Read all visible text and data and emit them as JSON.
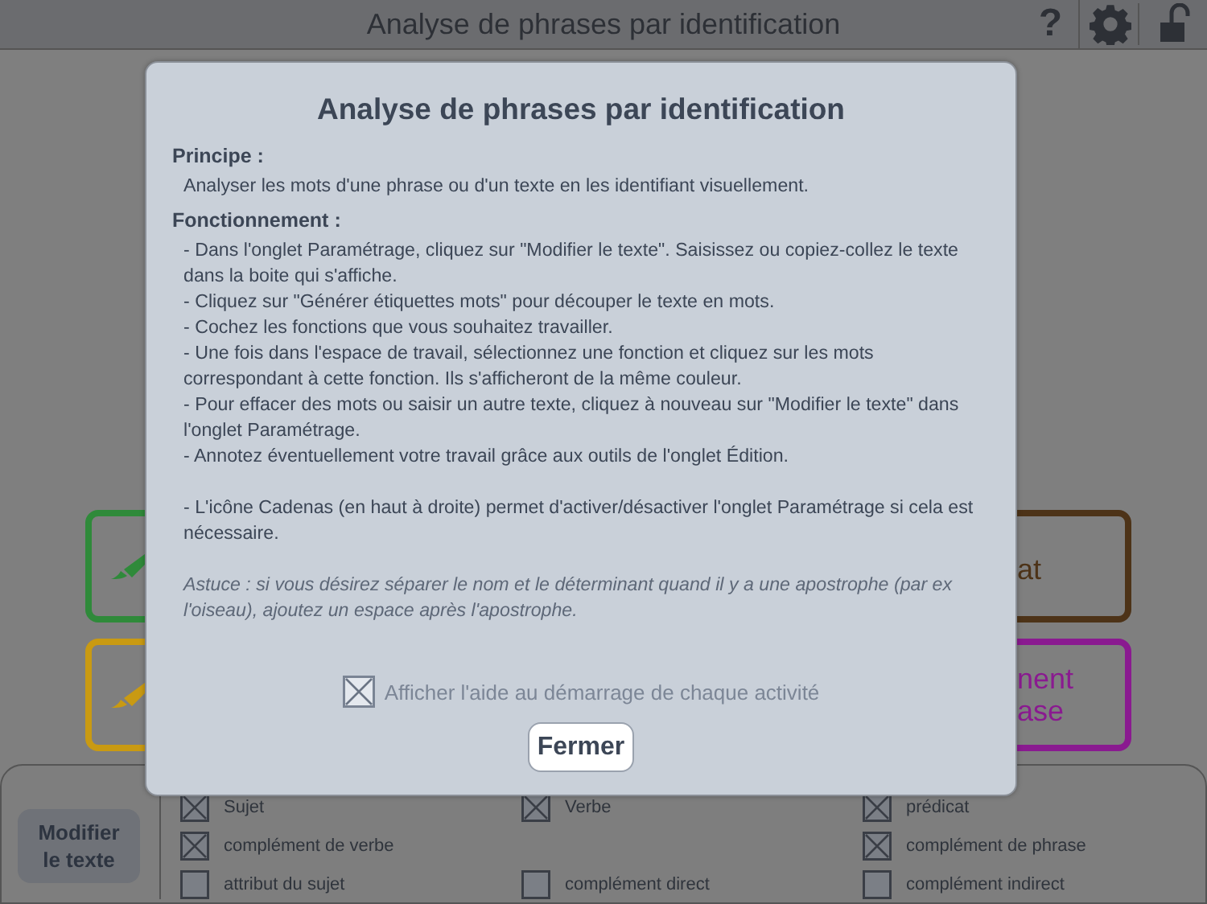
{
  "title_bar": {
    "title": "Analyse de phrases par identification",
    "help": "?"
  },
  "cards": [
    {
      "color": "#2f8a3a",
      "kind": "pencil"
    },
    {
      "text": "at",
      "color": "#4d3318",
      "kind": "label"
    },
    {
      "color": "#c99a12",
      "kind": "pencil"
    },
    {
      "text": "nent\nase",
      "color": "#8a1a90",
      "kind": "label"
    }
  ],
  "bottom_panel": {
    "button": "Modifier\nle texte",
    "rows": [
      [
        {
          "kind": "checkbox",
          "label": "Sujet",
          "checked": true
        },
        {
          "kind": "checkbox",
          "label": "Verbe",
          "checked": true
        },
        {
          "kind": "checkbox",
          "label": "prédicat",
          "checked": true
        }
      ],
      [
        {
          "kind": "checkbox",
          "label": "complément de verbe",
          "checked": true
        },
        {
          "kind": "blank"
        },
        {
          "kind": "checkbox",
          "label": "complément de phrase",
          "checked": true
        }
      ],
      [
        {
          "kind": "checkbox",
          "label": "attribut du sujet",
          "checked": false
        },
        {
          "kind": "checkbox",
          "label": "complément direct",
          "checked": false
        },
        {
          "kind": "checkbox",
          "label": "complément indirect",
          "checked": false
        }
      ]
    ]
  },
  "dialog": {
    "title": "Analyse de phrases par identification",
    "sections": [
      {
        "heading": "Principe :",
        "paragraphs": [
          "Analyser les mots d'une phrase ou d'un texte en les identifiant visuellement."
        ]
      },
      {
        "heading": "Fonctionnement :",
        "paragraphs": [
          "- Dans l'onglet Paramétrage, cliquez sur \"Modifier le texte\". Saisissez ou copiez-collez le texte dans la boite qui s'affiche.",
          "- Cliquez sur \"Générer étiquettes mots\" pour découper le texte en mots.",
          "- Cochez les fonctions que vous souhaitez travailler.",
          "- Une fois dans l'espace de travail, sélectionnez une fonction et cliquez sur les mots correspondant à cette fonction. Ils s'afficheront de la même couleur.",
          "- Pour effacer des mots ou saisir un autre texte, cliquez à nouveau sur \"Modifier le texte\" dans l'onglet Paramétrage.",
          "- Annotez éventuellement votre travail grâce aux outils de l'onglet Édition."
        ]
      }
    ],
    "note": "- L'icône Cadenas (en haut à droite) permet d'activer/désactiver l'onglet Paramétrage si cela est nécessaire.",
    "tip": "Astuce : si vous désirez séparer le nom et le déterminant quand il y a une apostrophe (par ex l'oiseau), ajoutez un espace après l'apostrophe.",
    "show_at_start": {
      "label": "Afficher l'aide au démarrage de chaque activité",
      "checked": true
    },
    "close": "Fermer"
  }
}
